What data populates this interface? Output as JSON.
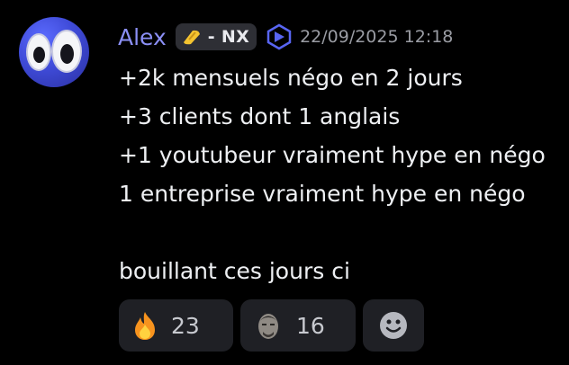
{
  "message": {
    "author": "Alex",
    "role_tag": "- NX",
    "timestamp": "22/09/2025 12:18",
    "lines": [
      "+2k mensuels négo en 2 jours",
      "+3 clients dont 1 anglais",
      "+1 youtubeur vraiment hype en négo",
      "1 entreprise vraiment hype en négo",
      "",
      "bouillant ces jours ci"
    ]
  },
  "reactions": [
    {
      "icon": "fire-emoji-icon",
      "count": "23"
    },
    {
      "icon": "custom-face-emoji-icon",
      "count": "16"
    },
    {
      "icon": "add-reaction-icon"
    }
  ],
  "colors": {
    "background": "#000000",
    "author": "#8b8ff5",
    "timestamp": "#9a9ca3",
    "reaction_bg": "#1f2025",
    "tag_bg": "#2e2f35"
  }
}
